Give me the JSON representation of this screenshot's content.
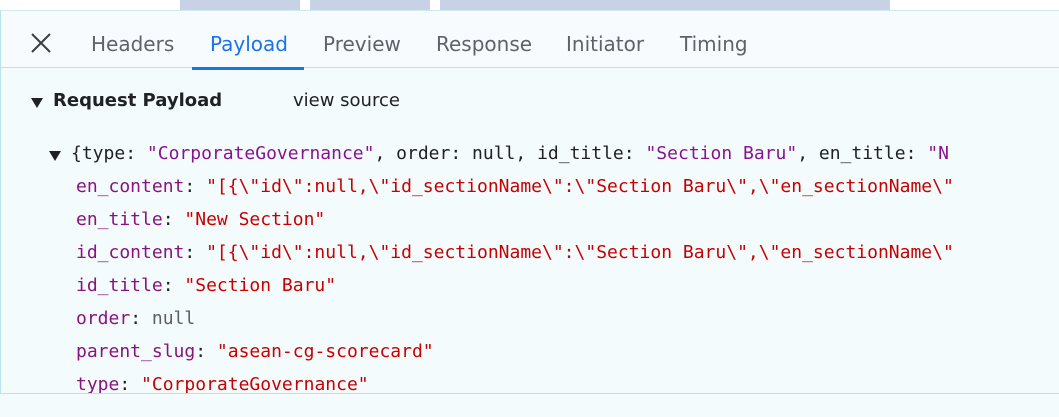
{
  "tabs": {
    "headers": "Headers",
    "payload": "Payload",
    "preview": "Preview",
    "response": "Response",
    "initiator": "Initiator",
    "timing": "Timing"
  },
  "section": {
    "title": "Request Payload",
    "view_source": "view source"
  },
  "summary": {
    "open": "{",
    "pair1_key": "type",
    "pair1_val": "\"CorporateGovernance\"",
    "pair2_key": "order",
    "pair2_val": "null",
    "pair3_key": "id_title",
    "pair3_val": "\"Section Baru\"",
    "pair4_key": "en_title",
    "pair4_val": "\"N"
  },
  "props": [
    {
      "key": "en_content",
      "value": "\"[{\\\"id\\\":null,\\\"id_sectionName\\\":\\\"Section Baru\\\",\\\"en_sectionName\\\""
    },
    {
      "key": "en_title",
      "value": "\"New Section\""
    },
    {
      "key": "id_content",
      "value": "\"[{\\\"id\\\":null,\\\"id_sectionName\\\":\\\"Section Baru\\\",\\\"en_sectionName\\\""
    },
    {
      "key": "id_title",
      "value": "\"Section Baru\""
    },
    {
      "key": "order",
      "value": "null"
    },
    {
      "key": "parent_slug",
      "value": "\"asean-cg-scorecard\""
    },
    {
      "key": "type",
      "value": "\"CorporateGovernance\""
    }
  ],
  "colors": {
    "accent": "#1a73e8",
    "key": "#881280",
    "string": "#c80000",
    "border": "#b9e3ea",
    "background": "#f4fbfc"
  }
}
